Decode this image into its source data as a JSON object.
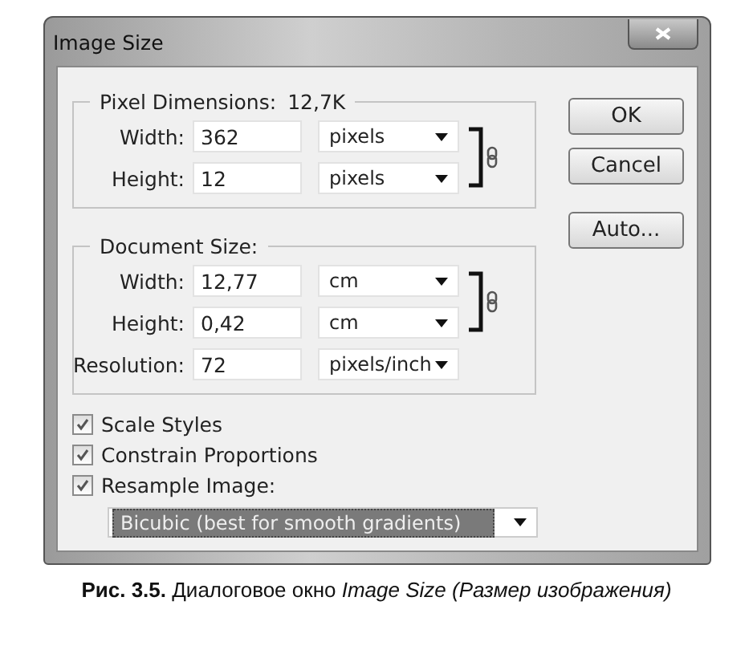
{
  "window": {
    "title": "Image Size"
  },
  "pixel_dimensions": {
    "title": "Pixel Dimensions:",
    "value": "12,7K",
    "rows": [
      {
        "label": "Width:",
        "value": "362",
        "unit": "pixels",
        "constrained": true
      },
      {
        "label": "Height:",
        "value": "12",
        "unit": "pixels",
        "constrained": true
      }
    ]
  },
  "document_size": {
    "title": "Document Size:",
    "rows": [
      {
        "label": "Width:",
        "value": "12,77",
        "unit": "cm",
        "constrained": true
      },
      {
        "label": "Height:",
        "value": "0,42",
        "unit": "cm",
        "constrained": true
      },
      {
        "label": "Resolution:",
        "value": "72",
        "unit": "pixels/inch",
        "constrained": false
      }
    ]
  },
  "checkboxes": [
    {
      "label": "Scale Styles",
      "checked": true
    },
    {
      "label": "Constrain Proportions",
      "checked": true
    },
    {
      "label": "Resample Image:",
      "checked": true
    }
  ],
  "resample_method": {
    "value": "Bicubic (best for smooth gradients)",
    "selected": true
  },
  "buttons": [
    "OK",
    "Cancel",
    "Auto..."
  ],
  "caption": "**Рис. 3.5.** Диалоговое окно *Image Size (Размер изображения)*"
}
